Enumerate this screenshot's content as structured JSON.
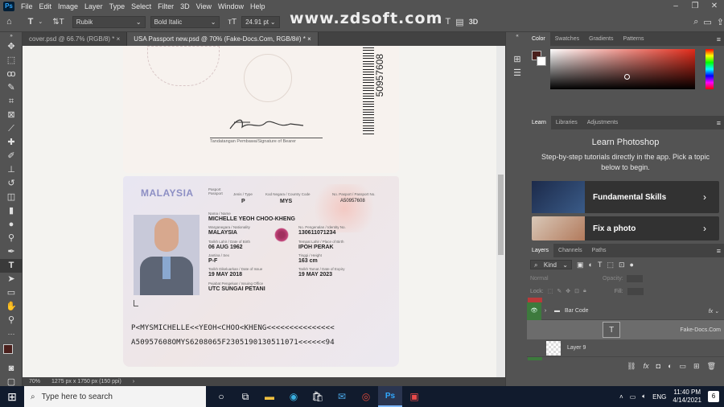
{
  "app": {
    "logo": "Ps",
    "menus": [
      "File",
      "Edit",
      "Image",
      "Layer",
      "Type",
      "Select",
      "Filter",
      "3D",
      "View",
      "Window",
      "Help"
    ]
  },
  "window_buttons": [
    "–",
    "❐",
    "✕"
  ],
  "watermark": "www.zdsoft.com",
  "options": {
    "font_family": "Rubik",
    "font_style": "Bold Italic",
    "font_size": "24.91 pt",
    "threed": "3D"
  },
  "tabs": [
    {
      "label": "cover.psd @ 66.7% (RGB/8) *",
      "active": false
    },
    {
      "label": "USA Passport new.psd @ 70% (Fake-Docs.Com, RGB/8#) *",
      "active": true
    }
  ],
  "status": {
    "zoom": "70%",
    "doc_info": "1275 px x 1750 px (150 ppi)"
  },
  "passport": {
    "number_vertical": "50957608",
    "signature_caption": "Tandatangan Pembawa/Signature of Bearer",
    "country": "MALAYSIA",
    "passport_label": "Pasport\nPassport",
    "type_label": "Jenis / Type",
    "type": "P",
    "country_code_label": "Kod Negara / Country Code",
    "country_code": "MYS",
    "passport_no_label": "No. Pasport / Passport No.",
    "passport_no": "A50957608",
    "name_label": "Nama / Name",
    "name": "MICHELLE YEOH CHOO-KHENG",
    "nationality_label": "Warganegara / Nationality",
    "nationality": "MALAYSIA",
    "id_label": "No. Pengenalan / Identity No.",
    "id_no": "130611071234",
    "dob_label": "Tarikh Lahir / Date of Birth",
    "dob": "06 AUG 1962",
    "pob_label": "Tempat Lahir / Place of Birth",
    "pob": "IPOH PERAK",
    "sex_label": "Jantina / Sex",
    "sex": "P-F",
    "height_label": "Tinggi / Height",
    "height": "163 cm",
    "issue_label": "Tarikh Dikeluarkan / Date of Issue",
    "issue": "19 MAY 2018",
    "expiry_label": "Tarikh Tamat / Date of Expiry",
    "expiry": "19 MAY 2023",
    "office_label": "Pejabat Pengeluar / Issuing Office",
    "office": "UTC SUNGAI PETANI",
    "mrz1": "P<MYSMICHELLE<<YEOH<CHOO<KHENG<<<<<<<<<<<<<<<",
    "mrz2": "A50957608OMYS6208065F2305190130511071<<<<<<94"
  },
  "color_panel": {
    "tabs": [
      "Color",
      "Swatches",
      "Gradients",
      "Patterns"
    ]
  },
  "learn_panel": {
    "tabs": [
      "Learn",
      "Libraries",
      "Adjustments"
    ],
    "title": "Learn Photoshop",
    "desc": "Step-by-step tutorials directly in the app. Pick a topic below to begin.",
    "cards": [
      "Fundamental Skills",
      "Fix a photo"
    ]
  },
  "layers_panel": {
    "tabs": [
      "Layers",
      "Channels",
      "Paths"
    ],
    "kind": "Kind",
    "blend": "Normal",
    "opacity_label": "Opacity:",
    "lock_label": "Lock:",
    "fill_label": "Fill:",
    "layers": [
      "Bar Code",
      "Fake-Docs.Com",
      "Layer 9"
    ]
  },
  "taskbar": {
    "search": "Type here to search",
    "time": "11:40 PM",
    "date": "4/14/2021",
    "lang": "ENG",
    "notif": "6"
  }
}
